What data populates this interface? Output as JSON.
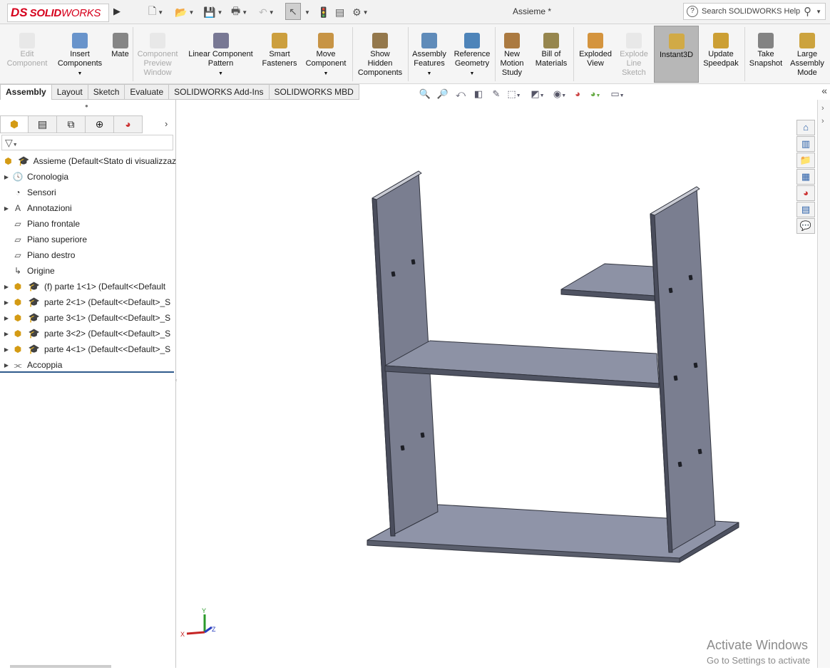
{
  "window": {
    "title": "Assieme *",
    "search_placeholder": "Search SOLIDWORKS Help"
  },
  "logo": {
    "ds": "DS",
    "brand_bold": "SOLID",
    "brand_rest": "WORKS"
  },
  "quick_access": [
    "new-icon",
    "open-icon",
    "save-icon",
    "print-icon",
    "undo-icon",
    "select-icon",
    "rebuild-icon",
    "file-properties-icon",
    "options-icon"
  ],
  "ribbon": {
    "items": [
      {
        "label": "Edit\nComponent",
        "disabled": true,
        "icon": "edit-component-icon"
      },
      {
        "label": "Insert\nComponents",
        "disabled": false,
        "icon": "insert-components-icon",
        "dropdown": true
      },
      {
        "label": "Mate",
        "disabled": false,
        "icon": "mate-icon"
      },
      {
        "label": "Component\nPreview\nWindow",
        "disabled": true,
        "icon": "preview-window-icon"
      },
      {
        "label": "Linear Component\nPattern",
        "disabled": false,
        "icon": "linear-pattern-icon",
        "dropdown": true
      },
      {
        "label": "Smart\nFasteners",
        "disabled": false,
        "icon": "smart-fasteners-icon"
      },
      {
        "label": "Move\nComponent",
        "disabled": false,
        "icon": "move-component-icon",
        "dropdown": true
      },
      {
        "label": "Show\nHidden\nComponents",
        "disabled": false,
        "icon": "show-hidden-icon"
      },
      {
        "label": "Assembly\nFeatures",
        "disabled": false,
        "icon": "assembly-features-icon",
        "dropdown": true
      },
      {
        "label": "Reference\nGeometry",
        "disabled": false,
        "icon": "reference-geometry-icon",
        "dropdown": true
      },
      {
        "label": "New\nMotion\nStudy",
        "disabled": false,
        "icon": "motion-study-icon"
      },
      {
        "label": "Bill of\nMaterials",
        "disabled": false,
        "icon": "bom-icon"
      },
      {
        "label": "Exploded\nView",
        "disabled": false,
        "icon": "exploded-view-icon"
      },
      {
        "label": "Explode\nLine\nSketch",
        "disabled": true,
        "icon": "explode-line-icon"
      },
      {
        "label": "Instant3D",
        "disabled": false,
        "icon": "instant3d-icon",
        "active": true
      },
      {
        "label": "Update\nSpeedpak",
        "disabled": false,
        "icon": "speedpak-icon"
      },
      {
        "label": "Take\nSnapshot",
        "disabled": false,
        "icon": "snapshot-icon"
      },
      {
        "label": "Large\nAssembly\nMode",
        "disabled": false,
        "icon": "large-assembly-icon"
      }
    ]
  },
  "tabs": [
    {
      "label": "Assembly",
      "active": true
    },
    {
      "label": "Layout",
      "active": false
    },
    {
      "label": "Sketch",
      "active": false
    },
    {
      "label": "Evaluate",
      "active": false
    },
    {
      "label": "SOLIDWORKS Add-Ins",
      "active": false
    },
    {
      "label": "SOLIDWORKS MBD",
      "active": false
    }
  ],
  "feature_tree": {
    "tabs": [
      "feature-manager-icon",
      "property-manager-icon",
      "configuration-manager-icon",
      "dimxpert-icon",
      "display-manager-icon"
    ],
    "root": "Assieme  (Default<Stato di visualizzaz",
    "items": [
      {
        "label": "Cronologia",
        "icon": "history-icon",
        "expand": true
      },
      {
        "label": "Sensori",
        "icon": "sensors-icon",
        "expand": false
      },
      {
        "label": "Annotazioni",
        "icon": "annotations-icon",
        "expand": true
      },
      {
        "label": "Piano frontale",
        "icon": "plane-icon",
        "expand": false
      },
      {
        "label": "Piano superiore",
        "icon": "plane-icon",
        "expand": false
      },
      {
        "label": "Piano destro",
        "icon": "plane-icon",
        "expand": false
      },
      {
        "label": "Origine",
        "icon": "origin-icon",
        "expand": false
      },
      {
        "label": "(f) parte 1<1> (Default<<Default",
        "icon": "part-icon",
        "expand": true,
        "part": true
      },
      {
        "label": "parte 2<1> (Default<<Default>_S",
        "icon": "part-icon",
        "expand": true,
        "part": true
      },
      {
        "label": "parte 3<1> (Default<<Default>_S",
        "icon": "part-icon",
        "expand": true,
        "part": true
      },
      {
        "label": "parte 3<2> (Default<<Default>_S",
        "icon": "part-icon",
        "expand": true,
        "part": true
      },
      {
        "label": "parte 4<1> (Default<<Default>_S",
        "icon": "part-icon",
        "expand": true,
        "part": true
      },
      {
        "label": "Accoppia",
        "icon": "mates-icon",
        "expand": true
      }
    ]
  },
  "triad": {
    "x": "X",
    "y": "Y",
    "z": "Z"
  },
  "watermark": {
    "line1": "Activate Windows",
    "line2": "Go to Settings to activate"
  }
}
